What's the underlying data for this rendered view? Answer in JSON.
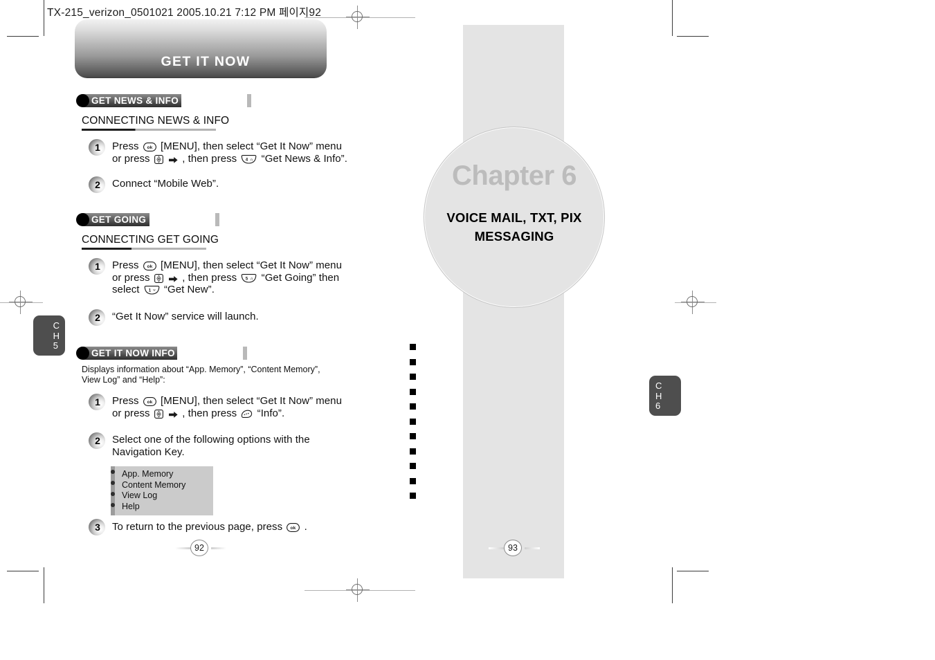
{
  "document": {
    "file_header": "TX-215_verizon_0501021  2005.10.21  7:12 PM  페이지92"
  },
  "left_page": {
    "banner_title": "GET IT NOW",
    "page_number": "92",
    "chapter_tab": {
      "ch_letters": "C\nH",
      "ch_number": "5"
    },
    "sections": [
      {
        "badge": "GET NEWS & INFO",
        "heading": "CONNECTING NEWS & INFO",
        "steps": [
          {
            "number": "1",
            "lines": [
              "Press [ok] [MENU], then select “Get It Now” menu",
              "or press [nav] ➜, then press [key4] “Get News & Info”."
            ]
          },
          {
            "number": "2",
            "lines": [
              "Connect “Mobile Web”."
            ]
          }
        ]
      },
      {
        "badge": "GET GOING",
        "heading": "CONNECTING GET GOING",
        "steps": [
          {
            "number": "1",
            "lines": [
              "Press [ok] [MENU], then select “Get It Now” menu",
              "or press [nav] ➜, then press [key5] “Get Going” then",
              "select [key1] “Get New”."
            ]
          },
          {
            "number": "2",
            "lines": [
              "“Get It Now” service will launch."
            ]
          }
        ]
      },
      {
        "badge": "GET IT NOW INFO",
        "note_lines": [
          "Displays information about “App. Memory”, “Content Memory”,",
          "View Log” and “Help”:"
        ],
        "steps": [
          {
            "number": "1",
            "lines": [
              "Press [ok] [MENU], then select “Get It Now” menu",
              "or press [nav] ➜, then press [soft] “Info”."
            ]
          },
          {
            "number": "2",
            "lines": [
              "Select one of the following options with the",
              "Navigation Key."
            ]
          },
          {
            "number": "3",
            "lines": [
              "To return to the previous page, press [ok] ."
            ]
          }
        ],
        "option_menu": [
          "App. Memory",
          "Content Memory",
          "View Log",
          "Help"
        ]
      }
    ]
  },
  "right_page": {
    "chapter_label": "Chapter 6",
    "chapter_subtitle": "VOICE MAIL, TXT, PIX MESSAGING",
    "page_number": "93",
    "chapter_tab": {
      "ch_letters": "C\nH",
      "ch_number": "6"
    },
    "marker_count": 11
  },
  "steps_text": {
    "s1_l1_a": "Press",
    "s1_l1_b": "[MENU], then select “Get It Now” menu",
    "s1_l2_a": "or press",
    "s1_l2_b": ", then press",
    "news_tail": "“Get News & Info”.",
    "going_tail": "“Get Going” then",
    "going_l3_a": "select",
    "going_l3_b": "“Get New”.",
    "info_tail": "“Info”.",
    "s2_news": "Connect “Mobile Web”.",
    "s2_going": "“Get It Now” service will launch.",
    "s2_info_l1": "Select one of the following options with the",
    "s2_info_l2": "Navigation Key.",
    "s3_info_a": "To return to the previous page, press",
    "s3_info_b": "."
  },
  "colors": {
    "banner_dark": "#3b3b3b",
    "panel_gray": "#e4e4e4",
    "tab_gray": "#4e4e4e",
    "menu_bullet_col": "#9c9c9c",
    "menu_item_col": "#cbcbcb",
    "chapter_label_gray": "#bcbcbc"
  }
}
